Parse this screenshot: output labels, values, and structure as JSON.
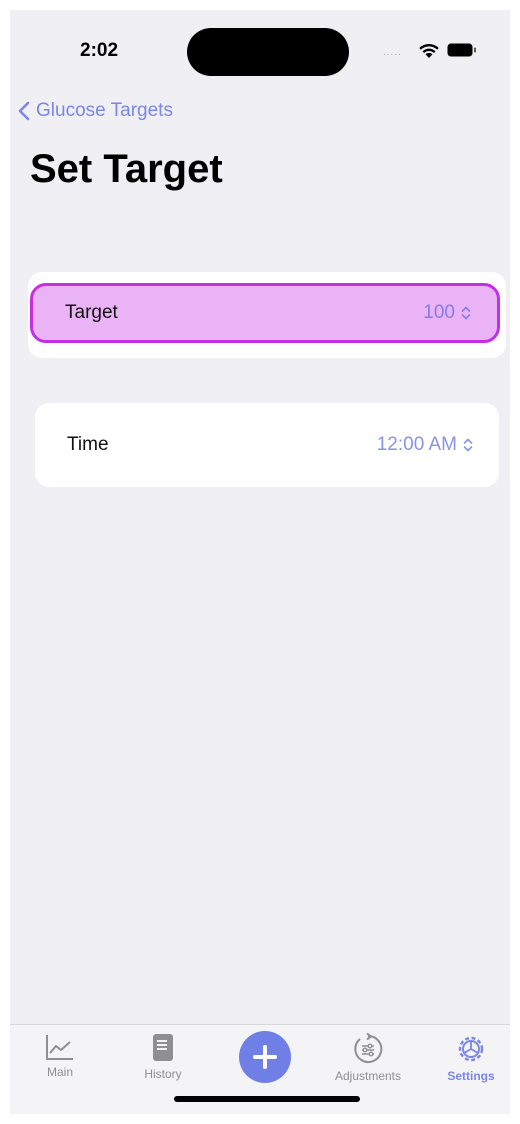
{
  "status_bar": {
    "time": "2:02",
    "signal_dots": "....."
  },
  "nav": {
    "back_label": "Glucose Targets",
    "title": "Set Target"
  },
  "rows": [
    {
      "label": "Target",
      "value": "100"
    },
    {
      "label": "Time",
      "value": "12:00 AM"
    }
  ],
  "tabbar": {
    "items": [
      {
        "label": "Main",
        "icon": "chart-icon"
      },
      {
        "label": "History",
        "icon": "book-icon"
      },
      {
        "label": "",
        "icon": "plus-icon"
      },
      {
        "label": "Adjustments",
        "icon": "adjustments-icon"
      },
      {
        "label": "Settings",
        "icon": "gear-icon",
        "selected": true
      }
    ]
  },
  "colors": {
    "accent": "#7b86e8",
    "highlight_fill": "#e9b3f5",
    "highlight_border": "#c42ee8",
    "background": "#efeff4"
  }
}
